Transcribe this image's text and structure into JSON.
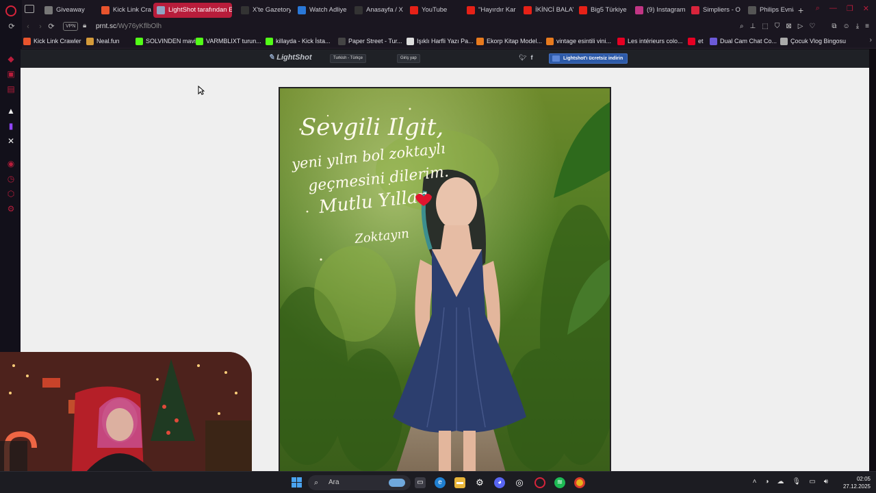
{
  "browser": {
    "tabs": [
      {
        "label": "Giveaway",
        "icon": "giveaway-icon",
        "color": "#777"
      },
      {
        "label": "Kick Link Cra",
        "icon": "kick-link-icon",
        "color": "#e8542d"
      },
      {
        "label": "LightShot tarafından Ek",
        "icon": "lightshot-feather-icon",
        "color": "#8fa4c3",
        "active": true
      },
      {
        "label": "X'te Gazetory",
        "icon": "x-icon",
        "color": "#333"
      },
      {
        "label": "Watch Adliye",
        "icon": "watch-icon",
        "color": "#2a78d8"
      },
      {
        "label": "Anasayfa / X",
        "icon": "x-icon",
        "color": "#333"
      },
      {
        "label": "YouTube",
        "icon": "youtube-icon",
        "color": "#e62117"
      },
      {
        "label": "\"Hayırdır Kar",
        "icon": "youtube-icon",
        "color": "#e62117"
      },
      {
        "label": "İKİNCİ BALAY",
        "icon": "youtube-icon",
        "color": "#e62117"
      },
      {
        "label": "Big5 Türkiye",
        "icon": "youtube-icon",
        "color": "#e62117"
      },
      {
        "label": "(9) Instagram",
        "icon": "instagram-icon",
        "color": "#c13584"
      },
      {
        "label": "Simpliers - O",
        "icon": "simpliers-icon",
        "color": "#d8243b"
      },
      {
        "label": "Philips Evnia",
        "icon": "philips-icon",
        "color": "#555"
      }
    ],
    "address": {
      "vpn_label": "VPN",
      "host": "prnt.sc",
      "path": "/Wy76yKflbOlh"
    },
    "bookmarks": [
      {
        "label": "Kick Link Crawler",
        "icon": "kick-link-icon",
        "color": "#e8542d"
      },
      {
        "label": "Neal.fun",
        "icon": "neal-icon",
        "color": "#d49a3a"
      },
      {
        "label": "SOLVINDEN mavi-...",
        "icon": "kick-icon",
        "color": "#53fc18"
      },
      {
        "label": "VARMBLIXT turun...",
        "icon": "kick-icon",
        "color": "#53fc18"
      },
      {
        "label": "killayda - Kick İsta...",
        "icon": "kick-icon",
        "color": "#53fc18"
      },
      {
        "label": "Paper Street - Tur...",
        "icon": "paper-street-icon",
        "color": "#444"
      },
      {
        "label": "Işıklı Harfli Yazı Pa...",
        "icon": "light-letter-icon",
        "color": "#ddd"
      },
      {
        "label": "Ekorp Kitap Model...",
        "icon": "ekorp-icon",
        "color": "#e77a1e"
      },
      {
        "label": "vintage esintili vini...",
        "icon": "vintage-icon",
        "color": "#e77a1e"
      },
      {
        "label": "Les intérieurs colo...",
        "icon": "pinterest-icon",
        "color": "#e60023"
      },
      {
        "label": "et",
        "icon": "pinterest-icon",
        "color": "#e60023"
      },
      {
        "label": "Dual Cam Chat Co...",
        "icon": "dual-cam-icon",
        "color": "#6c5ad8"
      },
      {
        "label": "Çocuk Vlog Bingosu",
        "icon": "document-icon",
        "color": "#aaa"
      }
    ]
  },
  "lightshot": {
    "logo": "LightShot",
    "lang_label": "Turkish - Türkçe",
    "login_label": "Giriş yap",
    "download_label": "Lightshot'ı ücretsiz indirin"
  },
  "screenshot_image": {
    "greeting_line1": "Sevgili Ilgit,",
    "greeting_line2": "yeni yılın bol zoktaylı",
    "greeting_line3": "geçmesini dilerim.",
    "greeting_line4": "Mutlu Yıllar",
    "signature": "Zoktayın"
  },
  "taskbar": {
    "search_placeholder": "Ara",
    "time": "02:05",
    "date": "27.12.2025"
  }
}
